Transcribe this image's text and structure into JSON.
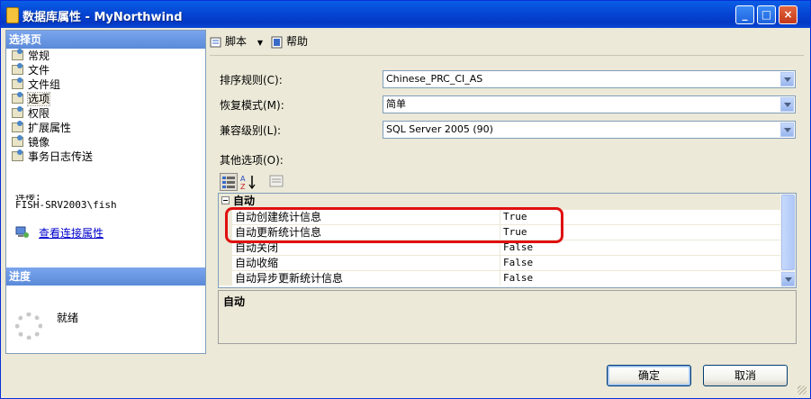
{
  "window": {
    "title": "数据库属性 - MyNorthwind",
    "controls": {
      "minimize": "_",
      "maximize": "□",
      "close": "×"
    }
  },
  "left_panel": {
    "select_page_header": "选择页",
    "nav_items": [
      {
        "label": "常规",
        "icon": "page-icon"
      },
      {
        "label": "文件",
        "icon": "page-icon"
      },
      {
        "label": "文件组",
        "icon": "page-icon"
      },
      {
        "label": "选项",
        "icon": "page-icon",
        "selected": true
      },
      {
        "label": "权限",
        "icon": "page-icon"
      },
      {
        "label": "扩展属性",
        "icon": "page-icon"
      },
      {
        "label": "镜像",
        "icon": "page-icon"
      },
      {
        "label": "事务日志传送",
        "icon": "page-icon"
      }
    ],
    "connection_label": "连接:",
    "connection_server": "FISH-SRV2003\\fish",
    "view_connection_link": "查看连接属性",
    "progress_header": "进度",
    "progress_status": "就绪"
  },
  "toolbar": {
    "script_label": "脚本",
    "help_label": "帮助"
  },
  "form": {
    "collation": {
      "label": "排序规则(C):",
      "value": "Chinese_PRC_CI_AS"
    },
    "recovery_model": {
      "label": "恢复模式(M):",
      "value": "简单"
    },
    "compatibility_level": {
      "label": "兼容级别(L):",
      "value": "SQL Server 2005 (90)"
    },
    "other_options_label": "其他选项(O):"
  },
  "property_grid": {
    "category": "自动",
    "rows": [
      {
        "name": "自动创建统计信息",
        "value": "True"
      },
      {
        "name": "自动更新统计信息",
        "value": "True"
      },
      {
        "name": "自动关闭",
        "value": "False"
      },
      {
        "name": "自动收缩",
        "value": "False"
      },
      {
        "name": "自动异步更新统计信息",
        "value": "False"
      }
    ],
    "description_title": "自动"
  },
  "buttons": {
    "ok": "确定",
    "cancel": "取消"
  },
  "colors": {
    "title_bar": "#0546d4",
    "section_header": "#6a96e0",
    "highlight": "#e01010",
    "link": "#0000cc"
  }
}
